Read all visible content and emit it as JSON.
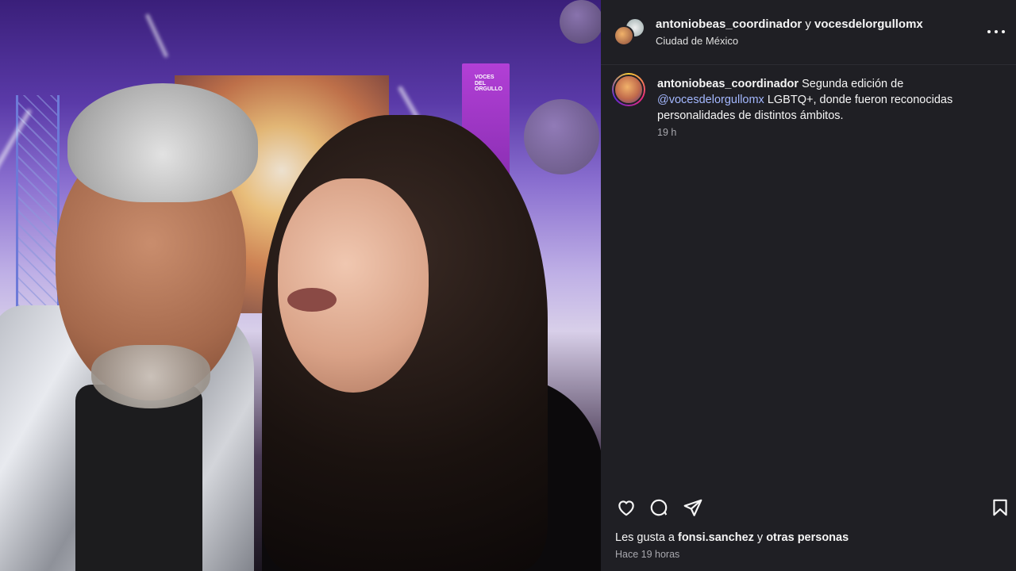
{
  "photo": {
    "banner_text": "VOCES DEL ORGULLO"
  },
  "header": {
    "account_1": "antoniobeas_coordinador",
    "conjunction": " y ",
    "account_2": "vocesdelorgullomx",
    "location": "Ciudad de México"
  },
  "caption": {
    "username": "antoniobeas_coordinador",
    "text_before_mention": " Segunda edición de ",
    "mention": "@vocesdelorgullomx",
    "text_after_mention": " LGBTQ+, donde fueron reconocidas personalidades de distintos ámbitos.",
    "time": "19 h"
  },
  "actions": {
    "like_icon": "heart-icon",
    "comment_icon": "comment-icon",
    "share_icon": "share-icon",
    "save_icon": "bookmark-icon"
  },
  "likes": {
    "prefix": "Les gusta a ",
    "user": "fonsi.sanchez",
    "middle": " y ",
    "others": "otras personas"
  },
  "posted": "Hace 19 horas",
  "colors": {
    "panel_bg": "#1f1f24",
    "mention": "#a4b8ff",
    "muted": "#a8a8ae"
  }
}
